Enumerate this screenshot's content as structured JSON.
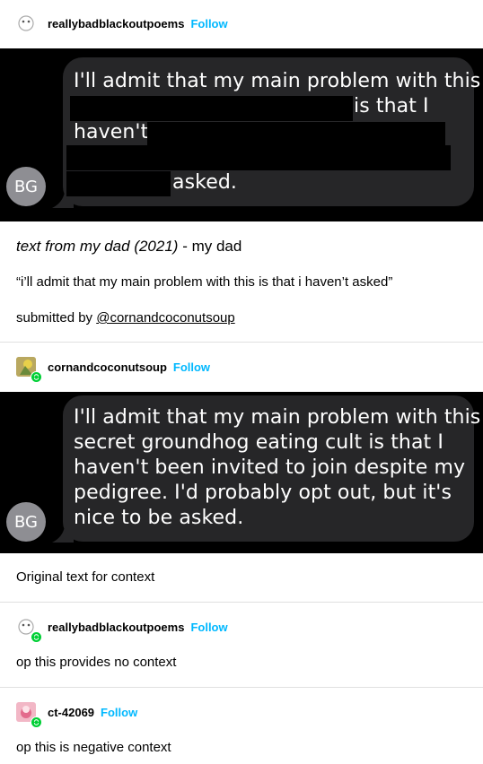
{
  "posts": [
    {
      "username": "reallybadblackoutpoems",
      "follow": "Follow"
    },
    {
      "username": "cornandcoconutsoup",
      "follow": "Follow"
    },
    {
      "username": "reallybadblackoutpoems",
      "follow": "Follow"
    },
    {
      "username": "ct-42069",
      "follow": "Follow"
    }
  ],
  "message1": {
    "avatar_initials": "BG",
    "lines": [
      "I'll admit that my main problem with this",
      "is that I",
      "haven't",
      "asked."
    ]
  },
  "caption": {
    "title_italic": "text from my dad (2021)",
    "title_rest": " - my dad",
    "quote": "“i’ll admit that my main problem with this is that i haven’t asked”",
    "submitted_prefix": "submitted by ",
    "submitted_link": "@cornandcoconutsoup"
  },
  "message2": {
    "avatar_initials": "BG",
    "lines": [
      "I'll admit that my main problem with this",
      "secret groundhog eating cult is that I",
      "haven't been invited to join despite my",
      "pedigree. I'd probably opt out, but it's",
      "nice to be asked."
    ]
  },
  "reblog_texts": {
    "original": "Original text for context",
    "no_context": "op this provides no context",
    "negative": "op this is negative context"
  },
  "colors": {
    "follow": "#00b8ff",
    "bubble": "#262628",
    "reblog_badge": "#00cf35",
    "avatar_gray": "#8e8e93"
  }
}
